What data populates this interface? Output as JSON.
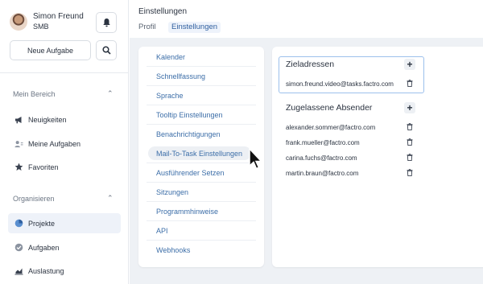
{
  "user": {
    "name": "Simon Freund",
    "org": "SMB"
  },
  "actions": {
    "new_task": "Neue Aufgabe"
  },
  "sidebar": {
    "section1": {
      "title": "Mein Bereich",
      "items": [
        {
          "label": "Neuigkeiten",
          "icon": "megaphone-icon"
        },
        {
          "label": "Meine Aufgaben",
          "icon": "user-tasks-icon"
        },
        {
          "label": "Favoriten",
          "icon": "star-icon"
        }
      ]
    },
    "section2": {
      "title": "Organisieren",
      "items": [
        {
          "label": "Projekte",
          "icon": "pie-icon",
          "active": true
        },
        {
          "label": "Aufgaben",
          "icon": "check-icon"
        },
        {
          "label": "Auslastung",
          "icon": "bar-chart-icon"
        }
      ]
    }
  },
  "header": {
    "breadcrumb": "Einstellungen",
    "tabs": [
      "Profil",
      "Einstellungen"
    ]
  },
  "settings_menu": [
    "Kalender",
    "Schnellfassung",
    "Sprache",
    "Tooltip Einstellungen",
    "Benachrichtigungen",
    "Mail-To-Task Einstellungen",
    "Ausführender Setzen",
    "Sitzungen",
    "Programmhinweise",
    "API",
    "Webhooks"
  ],
  "zieladressen": {
    "title": "Zieladressen",
    "emails": [
      "simon.freund.video@tasks.factro.com"
    ]
  },
  "absender": {
    "title": "Zugelassene Absender",
    "emails": [
      "alexander.sommer@factro.com",
      "frank.mueller@factro.com",
      "carina.fuchs@factro.com",
      "martin.braun@factro.com"
    ]
  },
  "colors": {
    "link": "#3c6ea8",
    "accent": "#2f5f9f",
    "active_bg": "#eef2f9"
  }
}
